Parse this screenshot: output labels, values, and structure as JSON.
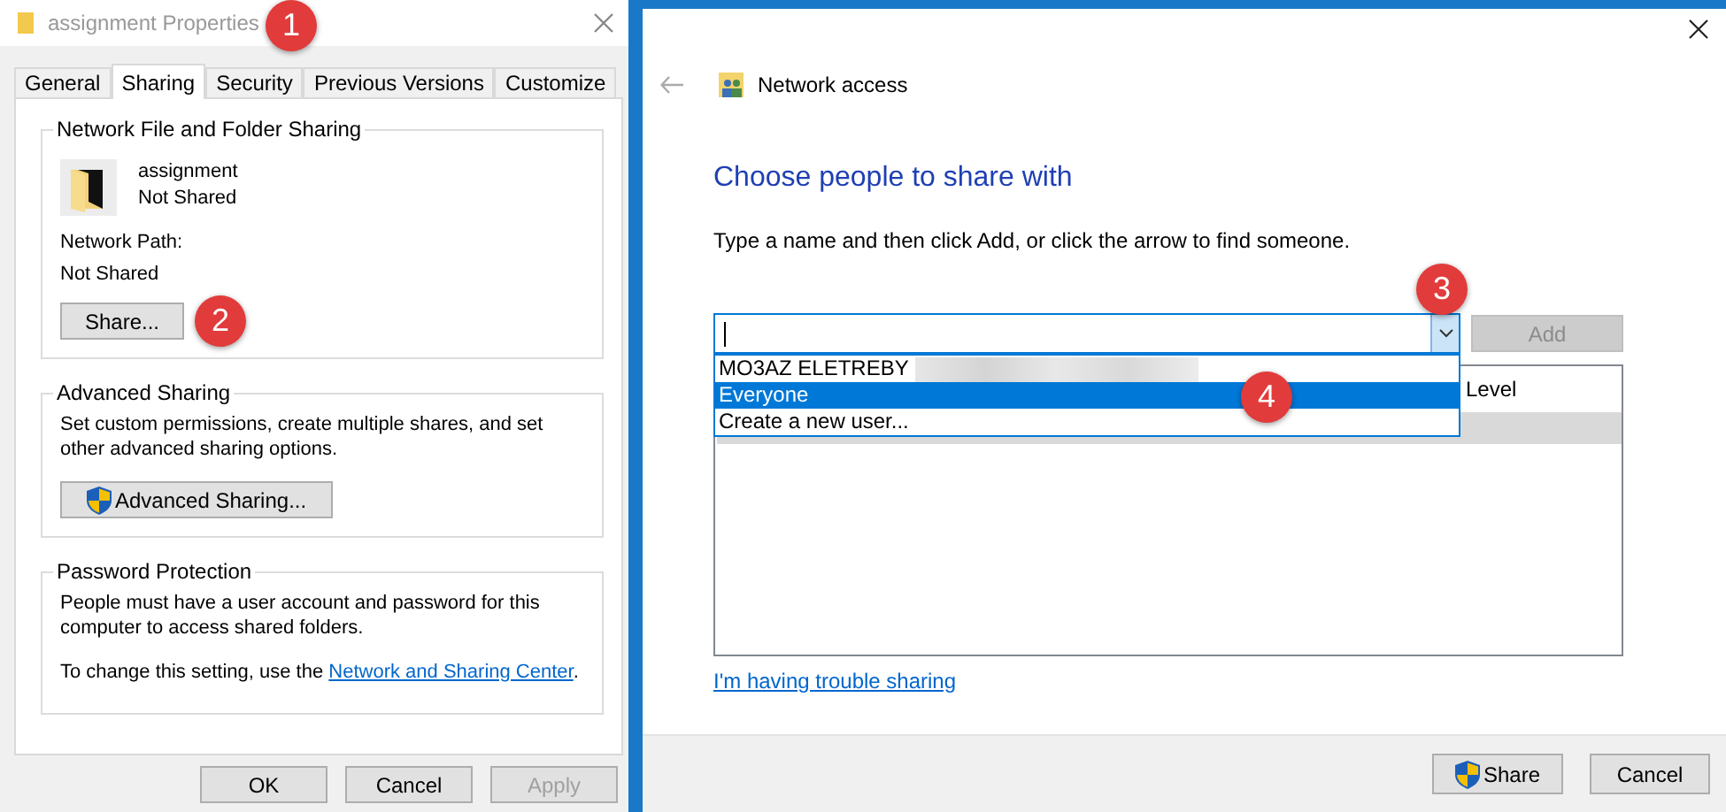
{
  "properties_window": {
    "title": "assignment Properties",
    "tabs": [
      {
        "label": "General",
        "selected": false
      },
      {
        "label": "Sharing",
        "selected": true
      },
      {
        "label": "Security",
        "selected": false
      },
      {
        "label": "Previous Versions",
        "selected": false
      },
      {
        "label": "Customize",
        "selected": false
      }
    ],
    "network_sharing": {
      "legend": "Network File and Folder Sharing",
      "folder_name": "assignment",
      "folder_status": "Not Shared",
      "path_label": "Network Path:",
      "path_value": "Not Shared",
      "share_button": "Share..."
    },
    "advanced_sharing": {
      "legend": "Advanced Sharing",
      "description": "Set custom permissions, create multiple shares, and set other advanced sharing options.",
      "button": "Advanced Sharing..."
    },
    "password_protection": {
      "legend": "Password Protection",
      "description": "People must have a user account and password for this computer to access shared folders.",
      "change_text": "To change this setting, use the ",
      "link": "Network and Sharing Center",
      "after_link": "."
    },
    "buttons": [
      {
        "label": "OK",
        "disabled": false
      },
      {
        "label": "Cancel",
        "disabled": false
      },
      {
        "label": "Apply",
        "disabled": true
      }
    ]
  },
  "share_window": {
    "title": "Network access",
    "heading": "Choose people to share with",
    "instruction": "Type a name and then click Add, or click the arrow to find someone.",
    "add_button": {
      "label": "Add",
      "disabled": true
    },
    "dropdown": [
      {
        "label": "MO3AZ ELETREBY",
        "selected": false
      },
      {
        "label": "Everyone",
        "selected": true
      },
      {
        "label": "Create a new user...",
        "selected": false
      }
    ],
    "list_columns": [
      "Level"
    ],
    "trouble_link": "I'm having trouble sharing",
    "buttons": [
      "Share",
      "Cancel"
    ]
  },
  "annotations": [
    "1",
    "2",
    "3",
    "4"
  ]
}
